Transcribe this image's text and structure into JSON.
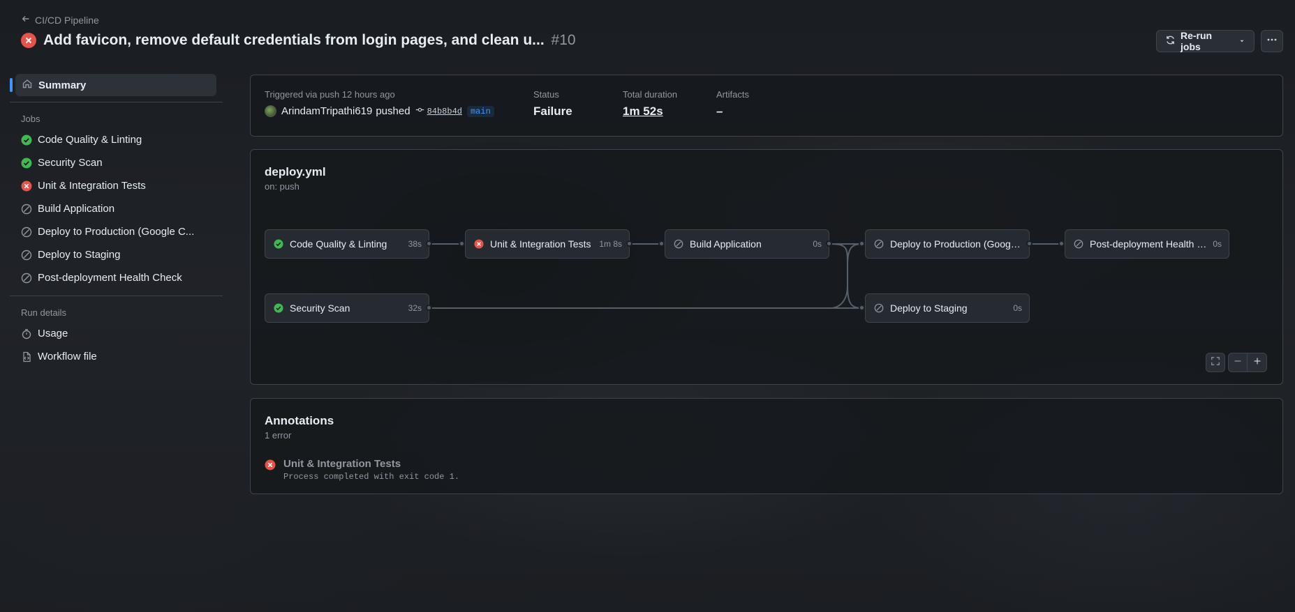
{
  "header": {
    "back_label": "CI/CD Pipeline",
    "title": "Add favicon, remove default credentials from login pages, and clean u...",
    "run_number": "#10",
    "rerun_label": "Re-run jobs",
    "more_icon": "kebab-horizontal-icon"
  },
  "sidebar": {
    "summary_label": "Summary",
    "jobs_heading": "Jobs",
    "jobs": [
      {
        "label": "Code Quality & Linting",
        "status": "success"
      },
      {
        "label": "Security Scan",
        "status": "success"
      },
      {
        "label": "Unit & Integration Tests",
        "status": "failure"
      },
      {
        "label": "Build Application",
        "status": "skipped"
      },
      {
        "label": "Deploy to Production (Google C...",
        "status": "skipped"
      },
      {
        "label": "Deploy to Staging",
        "status": "skipped"
      },
      {
        "label": "Post-deployment Health Check",
        "status": "skipped"
      }
    ],
    "run_details_heading": "Run details",
    "usage_label": "Usage",
    "workflow_file_label": "Workflow file"
  },
  "summary": {
    "triggered": "Triggered via push 12 hours ago",
    "actor": "ArindamTripathi619",
    "action": "pushed",
    "commit": "84b8b4d",
    "branch": "main",
    "status_label": "Status",
    "status_value": "Failure",
    "duration_label": "Total duration",
    "duration_value": "1m 52s",
    "artifacts_label": "Artifacts",
    "artifacts_value": "–"
  },
  "workflow": {
    "file": "deploy.yml",
    "trigger": "on: push",
    "jobs": {
      "code_quality": {
        "name": "Code Quality & Linting",
        "duration": "38s",
        "status": "success"
      },
      "security_scan": {
        "name": "Security Scan",
        "duration": "32s",
        "status": "success"
      },
      "unit_tests": {
        "name": "Unit & Integration Tests",
        "duration": "1m 8s",
        "status": "failure"
      },
      "build": {
        "name": "Build Application",
        "duration": "0s",
        "status": "skipped"
      },
      "deploy_prod": {
        "name": "Deploy to Production (Google...",
        "duration": "",
        "status": "skipped"
      },
      "deploy_staging": {
        "name": "Deploy to Staging",
        "duration": "0s",
        "status": "skipped"
      },
      "health_check": {
        "name": "Post-deployment Health C...",
        "duration": "0s",
        "status": "skipped"
      }
    }
  },
  "annotations": {
    "title": "Annotations",
    "count": "1 error",
    "items": [
      {
        "job": "Unit & Integration Tests",
        "message": "Process completed with exit code 1."
      }
    ]
  },
  "colors": {
    "success": "#3fb950",
    "failure": "#e5534b",
    "skipped": "#9198a1",
    "accent": "#4493f8"
  }
}
